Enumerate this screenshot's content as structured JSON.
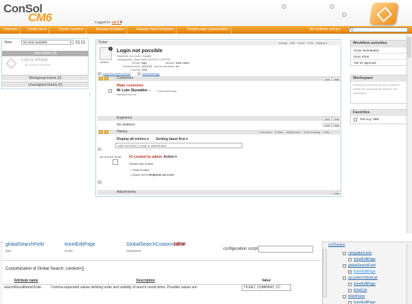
{
  "header": {
    "logo_main": "ConSol",
    "logo_sub": "CM6",
    "logged_prefix": "Logged in:",
    "user": "admin"
  },
  "nav": {
    "items": [
      "Overview",
      "Create ticket",
      "Create customer",
      "Manage templates",
      "Manage Word templates",
      "Enable page customization"
    ],
    "groups": "All customer groups",
    "search_placeholder": "Q"
  },
  "left": {
    "view_label": "View:",
    "view_value": "No view available",
    "own_tickets": "Own tickets (0)",
    "empty_title": "List is empty",
    "empty_sub": "No tickets available",
    "workgroup": "Workgroup tickets (0)",
    "unassigned": "Unassigned tickets (0)"
  },
  "ticket": {
    "header_title": "Ticket",
    "actions": [
      "Accept",
      "Edit",
      "Clone",
      "Print",
      "Display ▾"
    ],
    "subject": "Login not possible",
    "number": "100620",
    "queue": "HelpDesk 1st Level | Qualify",
    "status_line": "Unassigned | Open since 12/10/13 3:35 PM",
    "priority_label": "Priority",
    "priority": "high",
    "module_label": "Module",
    "module": "Web Client",
    "reaction_label": "Reaction time",
    "reaction": "12/11/13",
    "feedback_label": "Ask for feedback",
    "feedback": "no",
    "country_label": "Country",
    "country": "USA",
    "tab1": "customerSectionPanel",
    "tab2": "ticketEditPage",
    "customers_title": "Customers",
    "add": "Add",
    "hide": "Hide",
    "main_customer": "Main customer",
    "customer_name": "Mr Luke Skywalker",
    "customer_group": "CustomerGroup",
    "customer_email": "luke@consol.de",
    "engineers_title": "Engineers",
    "no_relations": "No relations",
    "history_title": "History",
    "history_actions": [
      "Comment",
      "E-Mail",
      "Attachment",
      "Time booking",
      "Hide"
    ],
    "display_all": "Display all entries ▾",
    "sorting": "Sorting latest first ▾",
    "comment_placeholder": "Add comment, e-mail or attachment",
    "entry_date": "16.12.2013 15:35",
    "entry_title": "#1 created by admin",
    "entry_action": "Action ▾",
    "entry_text": "Please help, thanks",
    "bullet1": "Ticket created",
    "bullet2_prefix": "Queue set to",
    "bullet2_value": "HelpDesk 1st Level",
    "attachments_title": "Attachments"
  },
  "right": {
    "workflow_title": "Workflow activities",
    "workflow_items": [
      "Close immediately",
      "Deny ticket",
      "Ask for approval"
    ],
    "workspace_title": "Workspace",
    "workspace_text": "Workspace is empty. All your unsaved tickets are automatically listed in this workspace.",
    "favorites_title": "Favorites",
    "favorite_item": "Test w.g. ABB"
  },
  "doc": {
    "col1_title": "globalSearchField",
    "col1_sub": "type",
    "col2_title": "ticketEditPage",
    "col2_sub": "scope",
    "col3_title": "GlobalSearchCustomization",
    "col3_sub": "classname",
    "new_badge": "NEW",
    "config_label": "configuration script:",
    "heading": "Customization of Global Search, context=[]",
    "th_name": "Attribute name",
    "th_desc": "Description",
    "th_value": "Value",
    "row_name": "searchResultItemsOrder",
    "row_desc": "Comma-seperated values defining order and visibility of search result items. Possible values are:",
    "row_value": "TICKET, COMPANY, CC",
    "tree_top": "cmClasses",
    "tree": [
      "navigationLinks",
      "ticketEditPage",
      "globalSearchField",
      "ticketEditPage",
      "accordionTicketList",
      "ticketEditPage",
      "ticketList",
      "ticketPanel",
      "ticketEditPage"
    ]
  }
}
